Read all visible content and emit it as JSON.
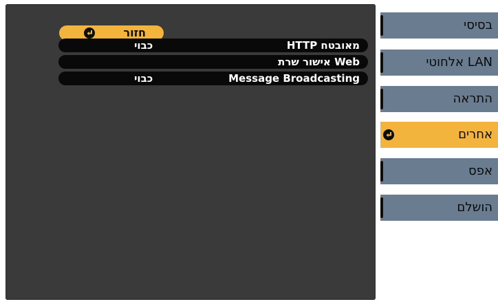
{
  "back_button": {
    "label": "חזור"
  },
  "settings": [
    {
      "name": "HTTP מאובטח",
      "value": "כבוי"
    },
    {
      "name": "אישור שרת Web",
      "value": ""
    },
    {
      "name": "Message Broadcasting",
      "value": "כבוי"
    }
  ],
  "menu": [
    {
      "label": "בסיסי"
    },
    {
      "label": "LAN אלחוטי"
    },
    {
      "label": "התראה"
    },
    {
      "label": "אחרים"
    },
    {
      "label": "אפס"
    },
    {
      "label": "הושלם"
    }
  ],
  "colors": {
    "panel": "#3a3a3a",
    "highlight": "#f2b43c",
    "menu": "#6a7d90",
    "row": "#090909"
  }
}
